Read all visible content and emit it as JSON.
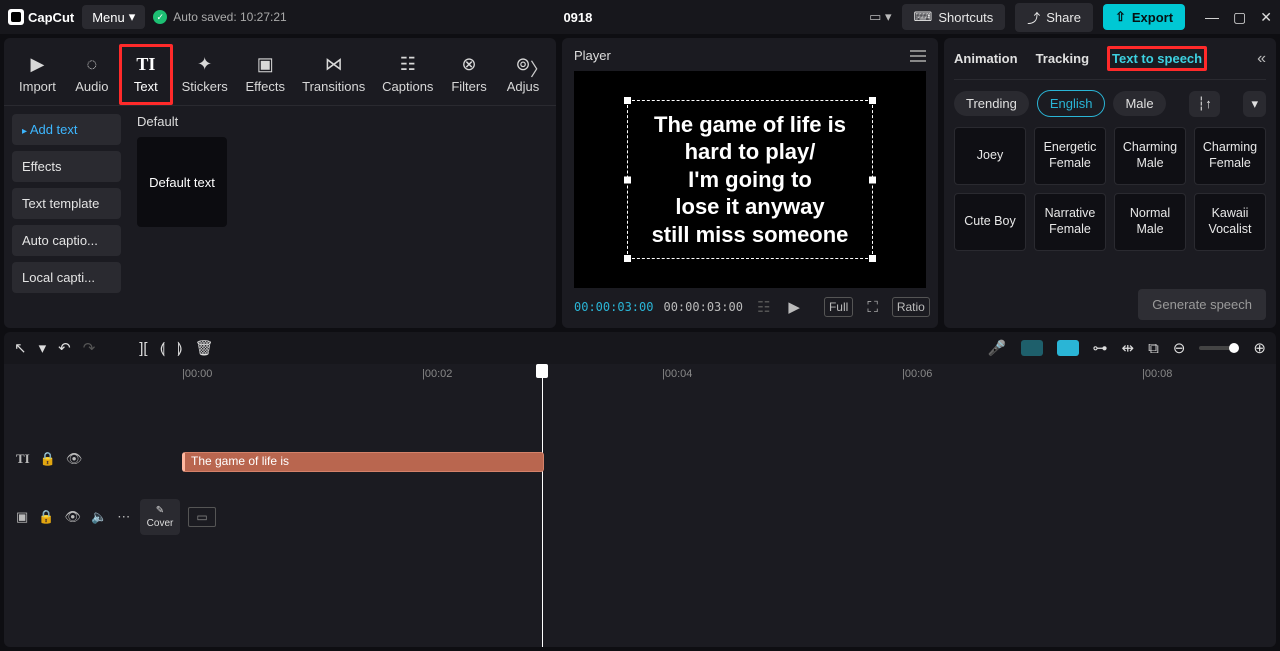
{
  "titlebar": {
    "logo": "CapCut",
    "menu_label": "Menu",
    "autosave_label": "Auto saved: 10:27:21",
    "project_title": "0918",
    "shortcuts": "Shortcuts",
    "share": "Share",
    "export": "Export"
  },
  "media_tabs": {
    "import": "Import",
    "audio": "Audio",
    "text": "Text",
    "stickers": "Stickers",
    "effects": "Effects",
    "transitions": "Transitions",
    "captions": "Captions",
    "filters": "Filters",
    "adjust": "Adjus"
  },
  "text_sidebar": {
    "add_text": "Add text",
    "effects": "Effects",
    "text_template": "Text template",
    "auto_captions": "Auto captio...",
    "local_captions": "Local capti..."
  },
  "text_content": {
    "section_title": "Default",
    "default_thumb": "Default text"
  },
  "player": {
    "label": "Player",
    "text_lines": [
      "The game of life is",
      "hard to play/",
      "I'm going to",
      "lose it anyway",
      "still miss someone"
    ],
    "time_current": "00:00:03:00",
    "time_total": "00:00:03:00",
    "full": "Full",
    "ratio": "Ratio"
  },
  "props": {
    "tabs": {
      "animation": "Animation",
      "tracking": "Tracking",
      "tts": "Text to speech"
    },
    "filters": {
      "trending": "Trending",
      "english": "English",
      "male": "Male"
    },
    "voices": [
      "Joey",
      "Energetic Female",
      "Charming Male",
      "Charming Female",
      "Cute Boy",
      "Narrative Female",
      "Normal Male",
      "Kawaii Vocalist"
    ],
    "generate": "Generate speech"
  },
  "timeline": {
    "ruler": [
      "|00:00",
      "|00:02",
      "|00:04",
      "|00:06",
      "|00:08"
    ],
    "text_clip_label": "The game of life is",
    "cover": "Cover"
  }
}
